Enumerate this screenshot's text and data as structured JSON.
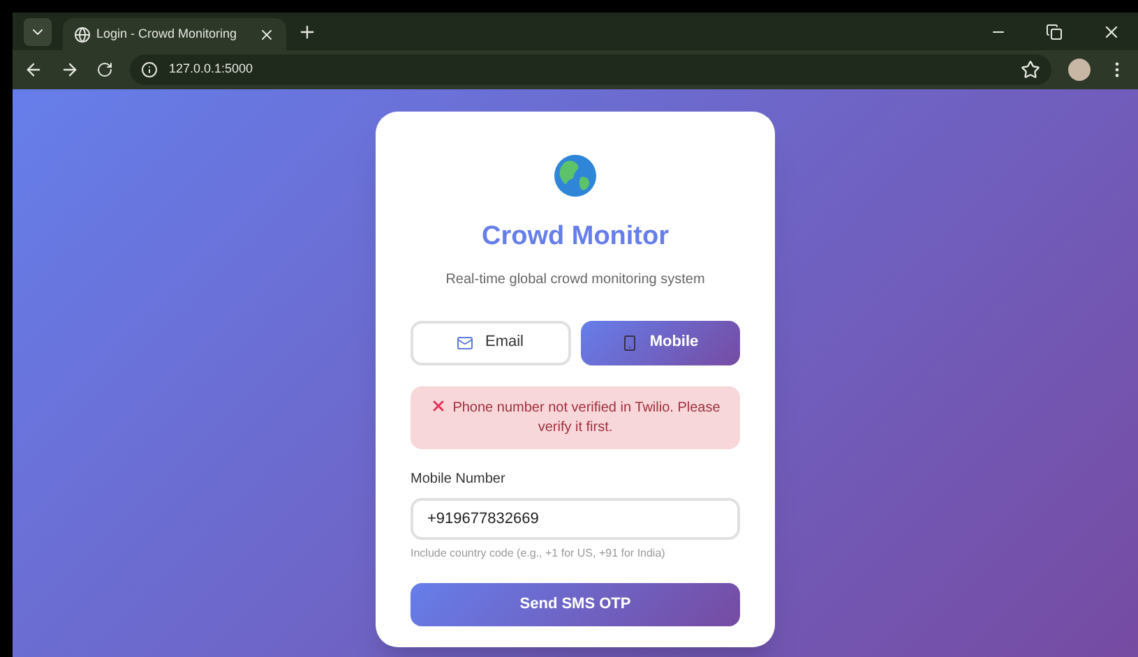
{
  "browser": {
    "tab_title": "Login - Crowd Monitoring",
    "url": "127.0.0.1:5000"
  },
  "card": {
    "title": "Crowd Monitor",
    "subtitle": "Real-time global crowd monitoring system",
    "tabs": [
      {
        "label": "Email",
        "kind": "email",
        "selected": false
      },
      {
        "label": "Mobile",
        "kind": "mobile",
        "selected": true
      }
    ],
    "error": "Phone number not verified in Twilio. Please verify it first.",
    "field": {
      "label": "Mobile Number",
      "value": "+919677832669",
      "hint": "Include country code (e.g., +1 for US, +91 for India)"
    },
    "submit": "Send SMS OTP"
  }
}
